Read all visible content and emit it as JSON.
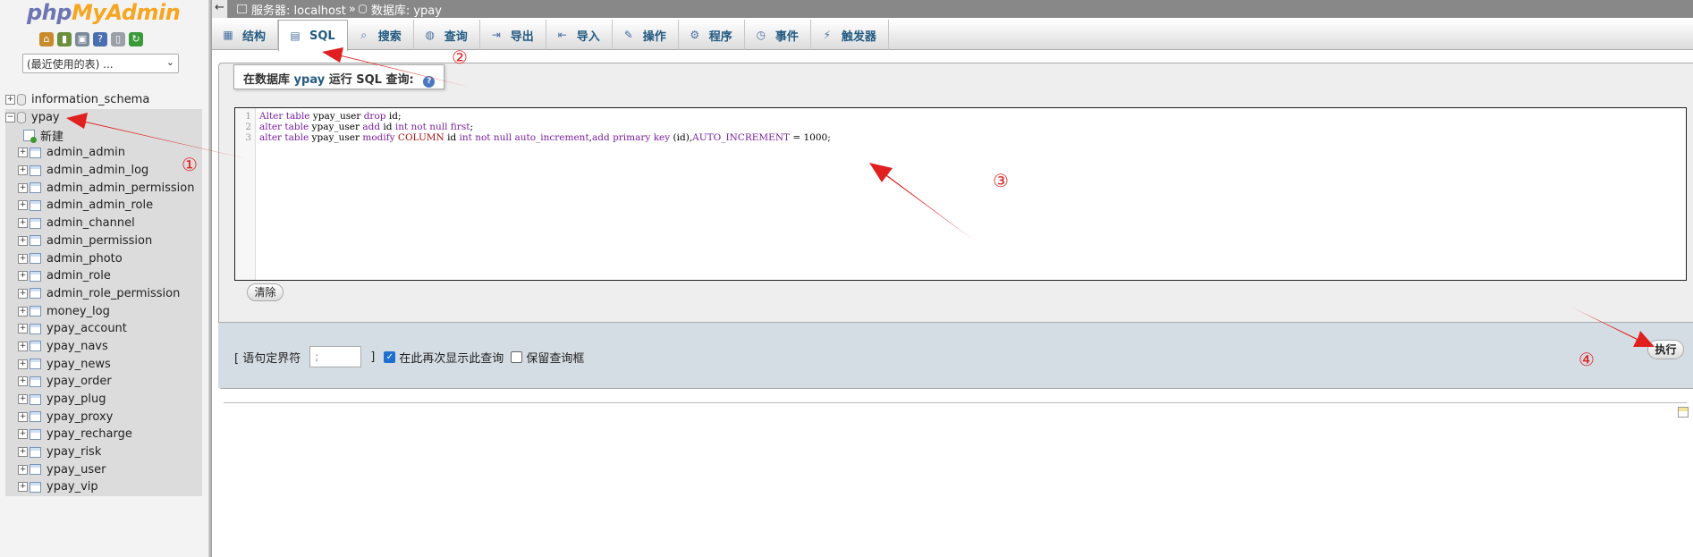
{
  "nav": {
    "logo_php": "php",
    "logo_myadmin": "MyAdmin",
    "recent_tables": "(最近使用的表) ...",
    "databases": [
      {
        "name": "information_schema",
        "expanded": false
      },
      {
        "name": "ypay",
        "expanded": true
      }
    ],
    "new_label": "新建",
    "tables": [
      "admin_admin",
      "admin_admin_log",
      "admin_admin_permission",
      "admin_admin_role",
      "admin_channel",
      "admin_permission",
      "admin_photo",
      "admin_role",
      "admin_role_permission",
      "money_log",
      "ypay_account",
      "ypay_navs",
      "ypay_news",
      "ypay_order",
      "ypay_plug",
      "ypay_proxy",
      "ypay_recharge",
      "ypay_risk",
      "ypay_user",
      "ypay_vip"
    ]
  },
  "topbar": {
    "back": "←",
    "server": "服务器: localhost",
    "sep": "»",
    "database": "数据库: ypay"
  },
  "tabs": [
    {
      "label": "结构",
      "icon": "structure-icon",
      "glyph": "▦"
    },
    {
      "label": "SQL",
      "icon": "sql-icon",
      "glyph": "▤",
      "active": true
    },
    {
      "label": "搜索",
      "icon": "search-icon",
      "glyph": "⌕"
    },
    {
      "label": "查询",
      "icon": "query-icon",
      "glyph": "◍"
    },
    {
      "label": "导出",
      "icon": "export-icon",
      "glyph": "⇥"
    },
    {
      "label": "导入",
      "icon": "import-icon",
      "glyph": "⇤"
    },
    {
      "label": "操作",
      "icon": "wrench-icon",
      "glyph": "✎"
    },
    {
      "label": "程序",
      "icon": "routines-icon",
      "glyph": "⚙"
    },
    {
      "label": "事件",
      "icon": "clock-icon",
      "glyph": "◷"
    },
    {
      "label": "触发器",
      "icon": "trigger-icon",
      "glyph": "⚡"
    }
  ],
  "query": {
    "legend_prefix": "在数据库",
    "legend_db": "ypay",
    "legend_suffix": "运行 SQL 查询:",
    "lines": [
      {
        "n": "1",
        "text": "Alter table ypay_user drop id;"
      },
      {
        "n": "2",
        "text": "alter table ypay_user add id int not null first;"
      },
      {
        "n": "3",
        "text": "alter table ypay_user modify COLUMN id int not null auto_increment,add primary key (id),AUTO_INCREMENT = 1000;"
      }
    ],
    "clear_label": "清除"
  },
  "footer": {
    "delimiter_label": "[ 语句定界符",
    "delimiter_value": ";",
    "delimiter_close": "]",
    "show_again_label": "在此再次显示此查询",
    "show_again_checked": true,
    "retain_box_label": "保留查询框",
    "retain_box_checked": false,
    "execute_label": "执行"
  },
  "annotations": {
    "n1": "①",
    "n2": "②",
    "n3": "③",
    "n4": "④",
    "color": "#e02020"
  }
}
